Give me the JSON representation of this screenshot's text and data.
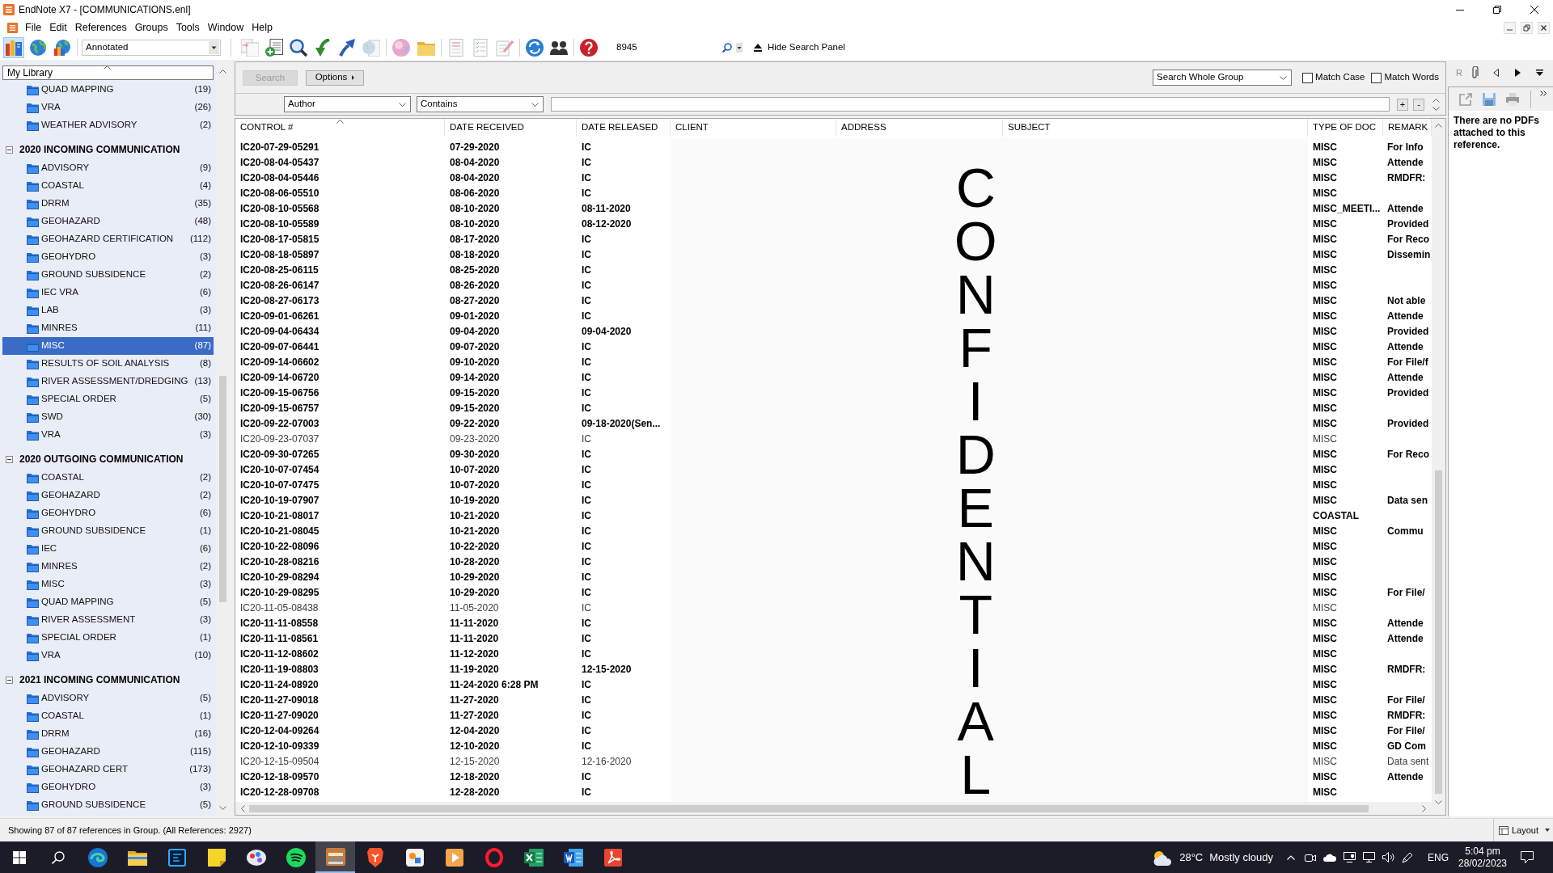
{
  "window": {
    "title": "EndNote X7 - [COMMUNICATIONS.enl]"
  },
  "menu": [
    "File",
    "Edit",
    "References",
    "Groups",
    "Tools",
    "Window",
    "Help"
  ],
  "toolbar": {
    "modes": [
      {
        "kind": "local",
        "selected": true
      },
      {
        "kind": "online",
        "selected": false
      },
      {
        "kind": "integrated",
        "selected": false
      }
    ],
    "style": "Annotated",
    "quick_search": "8945",
    "hide_search_panel": "Hide Search Panel"
  },
  "sidebar": {
    "library": "My Library",
    "group_sets": [
      {
        "children": [
          {
            "name": "QUAD MAPPING",
            "count": "(19)",
            "selected": false
          },
          {
            "name": "VRA",
            "count": "(26)",
            "selected": false
          },
          {
            "name": "WEATHER ADVISORY",
            "count": "(2)",
            "selected": false
          }
        ]
      },
      {
        "title": "2020 INCOMING COMMUNICATION",
        "expanded": true,
        "children": [
          {
            "name": "ADVISORY",
            "count": "(9)",
            "selected": false
          },
          {
            "name": "COASTAL",
            "count": "(4)",
            "selected": false
          },
          {
            "name": "DRRM",
            "count": "(35)",
            "selected": false
          },
          {
            "name": "GEOHAZARD",
            "count": "(48)",
            "selected": false
          },
          {
            "name": "GEOHAZARD CERTIFICATION",
            "count": "(112)",
            "selected": false
          },
          {
            "name": "GEOHYDRO",
            "count": "(3)",
            "selected": false
          },
          {
            "name": "GROUND SUBSIDENCE",
            "count": "(2)",
            "selected": false
          },
          {
            "name": "IEC VRA",
            "count": "(6)",
            "selected": false
          },
          {
            "name": "LAB",
            "count": "(3)",
            "selected": false
          },
          {
            "name": "MINRES",
            "count": "(11)",
            "selected": false
          },
          {
            "name": "MISC",
            "count": "(87)",
            "selected": true
          },
          {
            "name": "RESULTS OF SOIL ANALYSIS",
            "count": "(8)",
            "selected": false
          },
          {
            "name": "RIVER ASSESSMENT/DREDGING",
            "count": "(13)",
            "selected": false
          },
          {
            "name": "SPECIAL ORDER",
            "count": "(5)",
            "selected": false
          },
          {
            "name": "SWD",
            "count": "(30)",
            "selected": false
          },
          {
            "name": "VRA",
            "count": "(3)",
            "selected": false
          }
        ]
      },
      {
        "title": "2020 OUTGOING COMMUNICATION",
        "expanded": true,
        "children": [
          {
            "name": "COASTAL",
            "count": "(2)",
            "selected": false
          },
          {
            "name": "GEOHAZARD",
            "count": "(2)",
            "selected": false
          },
          {
            "name": "GEOHYDRO",
            "count": "(6)",
            "selected": false
          },
          {
            "name": "GROUND SUBSIDENCE",
            "count": "(1)",
            "selected": false
          },
          {
            "name": "IEC",
            "count": "(6)",
            "selected": false
          },
          {
            "name": "MINRES",
            "count": "(2)",
            "selected": false
          },
          {
            "name": "MISC",
            "count": "(3)",
            "selected": false
          },
          {
            "name": "QUAD MAPPING",
            "count": "(5)",
            "selected": false
          },
          {
            "name": "RIVER ASSESSMENT",
            "count": "(3)",
            "selected": false
          },
          {
            "name": "SPECIAL ORDER",
            "count": "(1)",
            "selected": false
          },
          {
            "name": "VRA",
            "count": "(10)",
            "selected": false
          }
        ]
      },
      {
        "title": "2021 INCOMING COMMUNICATION",
        "expanded": true,
        "children": [
          {
            "name": "ADVISORY",
            "count": "(5)",
            "selected": false
          },
          {
            "name": "COASTAL",
            "count": "(1)",
            "selected": false
          },
          {
            "name": "DRRM",
            "count": "(16)",
            "selected": false
          },
          {
            "name": "GEOHAZARD",
            "count": "(115)",
            "selected": false
          },
          {
            "name": "GEOHAZARD CERT",
            "count": "(173)",
            "selected": false
          },
          {
            "name": "GEOHYDRO",
            "count": "(3)",
            "selected": false
          },
          {
            "name": "GROUND SUBSIDENCE",
            "count": "(5)",
            "selected": false
          }
        ]
      }
    ]
  },
  "search_panel": {
    "search_button": {
      "label": "Search",
      "disabled": true
    },
    "options_button": "Options",
    "scope": "Search Whole Group",
    "match_case": {
      "label": "Match Case",
      "checked": false
    },
    "match_words": {
      "label": "Match Words",
      "checked": false
    },
    "field": "Author",
    "operator": "Contains",
    "add_button": "+",
    "remove_button": "-"
  },
  "table": {
    "columns": [
      {
        "label": "CONTROL #",
        "sorted": true
      },
      {
        "label": "DATE RECEIVED",
        "sorted": false
      },
      {
        "label": "DATE RELEASED",
        "sorted": false
      },
      {
        "label": "CLIENT",
        "sorted": false
      },
      {
        "label": "ADDRESS",
        "sorted": false
      },
      {
        "label": "SUBJECT",
        "sorted": false
      },
      {
        "label": "TYPE OF DOC",
        "sorted": false
      },
      {
        "label": "REMARK",
        "sorted": false
      }
    ],
    "rows": [
      {
        "control": "IC20-07-29-05291",
        "date_received": "07-29-2020",
        "date_released": "IC",
        "type_of_doc": "MISC",
        "remarks": "For Info",
        "unread": true
      },
      {
        "control": "IC20-08-04-05437",
        "date_received": "08-04-2020",
        "date_released": "IC",
        "type_of_doc": "MISC",
        "remarks": "Attende",
        "unread": true
      },
      {
        "control": "IC20-08-04-05446",
        "date_received": "08-04-2020",
        "date_released": "IC",
        "type_of_doc": "MISC",
        "remarks": "RMDFR:",
        "unread": true
      },
      {
        "control": "IC20-08-06-05510",
        "date_received": "08-06-2020",
        "date_released": "IC",
        "type_of_doc": "MISC",
        "unread": true
      },
      {
        "control": "IC20-08-10-05568",
        "date_received": "08-10-2020",
        "date_released": "08-11-2020",
        "type_of_doc": "MISC_MEETI...",
        "remarks": "Attende",
        "unread": true
      },
      {
        "control": "IC20-08-10-05589",
        "date_received": "08-10-2020",
        "date_released": "08-12-2020",
        "type_of_doc": "MISC",
        "remarks": "Provided",
        "unread": true
      },
      {
        "control": "IC20-08-17-05815",
        "date_received": "08-17-2020",
        "date_released": "IC",
        "type_of_doc": "MISC",
        "remarks": "For Reco",
        "unread": true
      },
      {
        "control": "IC20-08-18-05897",
        "date_received": "08-18-2020",
        "date_released": "IC",
        "type_of_doc": "MISC",
        "remarks": "Dissemin",
        "unread": true
      },
      {
        "control": "IC20-08-25-06115",
        "date_received": "08-25-2020",
        "date_released": "IC",
        "type_of_doc": "MISC",
        "unread": true
      },
      {
        "control": "IC20-08-26-06147",
        "date_received": "08-26-2020",
        "date_released": "IC",
        "type_of_doc": "MISC",
        "unread": true
      },
      {
        "control": "IC20-08-27-06173",
        "date_received": "08-27-2020",
        "date_released": "IC",
        "type_of_doc": "MISC",
        "remarks": "Not able",
        "unread": true
      },
      {
        "control": "IC20-09-01-06261",
        "date_received": "09-01-2020",
        "date_released": "IC",
        "type_of_doc": "MISC",
        "remarks": "Attende",
        "unread": true
      },
      {
        "control": "IC20-09-04-06434",
        "date_received": "09-04-2020",
        "date_released": "09-04-2020",
        "type_of_doc": "MISC",
        "remarks": "Provided",
        "unread": true
      },
      {
        "control": "IC20-09-07-06441",
        "date_received": "09-07-2020",
        "date_released": "IC",
        "type_of_doc": "MISC",
        "remarks": "Attende",
        "unread": true
      },
      {
        "control": "IC20-09-14-06602",
        "date_received": "09-10-2020",
        "date_released": "IC",
        "type_of_doc": "MISC",
        "remarks": "For File/f",
        "unread": true
      },
      {
        "control": "IC20-09-14-06720",
        "date_received": "09-14-2020",
        "date_released": "IC",
        "type_of_doc": "MISC",
        "remarks": "Attende",
        "unread": true
      },
      {
        "control": "IC20-09-15-06756",
        "date_received": "09-15-2020",
        "date_released": "IC",
        "type_of_doc": "MISC",
        "remarks": "Provided",
        "unread": true
      },
      {
        "control": "IC20-09-15-06757",
        "date_received": "09-15-2020",
        "date_released": "IC",
        "type_of_doc": "MISC",
        "unread": true
      },
      {
        "control": "IC20-09-22-07003",
        "date_received": "09-22-2020",
        "date_released": "09-18-2020(Sen...",
        "type_of_doc": "MISC",
        "remarks": "Provided",
        "unread": true
      },
      {
        "control": "IC20-09-23-07037",
        "date_received": "09-23-2020",
        "date_released": "IC",
        "type_of_doc": "MISC",
        "unread": false
      },
      {
        "control": "IC20-09-30-07265",
        "date_received": "09-30-2020",
        "date_released": "IC",
        "type_of_doc": "MISC",
        "remarks": "For Reco",
        "unread": true
      },
      {
        "control": "IC20-10-07-07454",
        "date_received": "10-07-2020",
        "date_released": "IC",
        "type_of_doc": "MISC",
        "unread": true
      },
      {
        "control": "IC20-10-07-07475",
        "date_received": "10-07-2020",
        "date_released": "IC",
        "type_of_doc": "MISC",
        "unread": true
      },
      {
        "control": "IC20-10-19-07907",
        "date_received": "10-19-2020",
        "date_released": "IC",
        "type_of_doc": "MISC",
        "remarks": "Data sen",
        "unread": true
      },
      {
        "control": "IC20-10-21-08017",
        "date_received": "10-21-2020",
        "date_released": "IC",
        "type_of_doc": "COASTAL",
        "unread": true
      },
      {
        "control": "IC20-10-21-08045",
        "date_received": "10-21-2020",
        "date_released": "IC",
        "type_of_doc": "MISC",
        "remarks": "Commu",
        "unread": true
      },
      {
        "control": "IC20-10-22-08096",
        "date_received": "10-22-2020",
        "date_released": "IC",
        "type_of_doc": "MISC",
        "unread": true
      },
      {
        "control": "IC20-10-28-08216",
        "date_received": "10-28-2020",
        "date_released": "IC",
        "type_of_doc": "MISC",
        "unread": true
      },
      {
        "control": "IC20-10-29-08294",
        "date_received": "10-29-2020",
        "date_released": "IC",
        "type_of_doc": "MISC",
        "unread": true
      },
      {
        "control": "IC20-10-29-08295",
        "date_received": "10-29-2020",
        "date_released": "IC",
        "type_of_doc": "MISC",
        "remarks": "For File/",
        "unread": true
      },
      {
        "control": "IC20-11-05-08438",
        "date_received": "11-05-2020",
        "date_released": "IC",
        "type_of_doc": "MISC",
        "unread": false
      },
      {
        "control": "IC20-11-11-08558",
        "date_received": "11-11-2020",
        "date_released": "IC",
        "type_of_doc": "MISC",
        "remarks": "Attende",
        "unread": true
      },
      {
        "control": "IC20-11-11-08561",
        "date_received": "11-11-2020",
        "date_released": "IC",
        "type_of_doc": "MISC",
        "remarks": "Attende",
        "unread": true
      },
      {
        "control": "IC20-11-12-08602",
        "date_received": "11-12-2020",
        "date_released": "IC",
        "type_of_doc": "MISC",
        "unread": true
      },
      {
        "control": "IC20-11-19-08803",
        "date_received": "11-19-2020",
        "date_released": "12-15-2020",
        "type_of_doc": "MISC",
        "remarks": "RMDFR:",
        "unread": true
      },
      {
        "control": "IC20-11-24-08920",
        "date_received": "11-24-2020 6:28 PM",
        "date_released": "IC",
        "type_of_doc": "MISC",
        "unread": true
      },
      {
        "control": "IC20-11-27-09018",
        "date_received": "11-27-2020",
        "date_released": "IC",
        "type_of_doc": "MISC",
        "remarks": "For File/",
        "unread": true
      },
      {
        "control": "IC20-11-27-09020",
        "date_received": "11-27-2020",
        "date_released": "IC",
        "type_of_doc": "MISC",
        "remarks": "RMDFR:",
        "unread": true
      },
      {
        "control": "IC20-12-04-09264",
        "date_received": "12-04-2020",
        "date_released": "IC",
        "type_of_doc": "MISC",
        "remarks": "For File/",
        "unread": true
      },
      {
        "control": "IC20-12-10-09339",
        "date_received": "12-10-2020",
        "date_released": "IC",
        "type_of_doc": "MISC",
        "remarks": "GD Com",
        "unread": true
      },
      {
        "control": "IC20-12-15-09504",
        "date_received": "12-15-2020",
        "date_released": "12-16-2020",
        "type_of_doc": "MISC",
        "remarks": "Data sent",
        "unread": false
      },
      {
        "control": "IC20-12-18-09570",
        "date_received": "12-18-2020",
        "date_released": "IC",
        "type_of_doc": "MISC",
        "remarks": "Attende",
        "unread": true
      },
      {
        "control": "IC20-12-28-09708",
        "date_received": "12-28-2020",
        "date_released": "IC",
        "type_of_doc": "MISC",
        "unread": true
      }
    ],
    "redaction": "CONFIDENTIAL"
  },
  "pdf_panel": {
    "tabs": [
      {
        "kind": "text",
        "label": "R",
        "selected": false
      },
      {
        "kind": "attachment",
        "selected": true
      }
    ],
    "message": "There are no PDFs attached to this reference."
  },
  "status_bar": {
    "text": "Showing 87 of 87 references in Group. (All References: 2927)",
    "layout_button": "Layout"
  },
  "taskbar": {
    "apps": [
      {
        "kind": "swirl",
        "active": false
      },
      {
        "kind": "folder",
        "active": false
      },
      {
        "kind": "photo",
        "active": false
      },
      {
        "kind": "note",
        "active": false
      },
      {
        "kind": "paint",
        "active": false
      },
      {
        "kind": "music",
        "active": false
      },
      {
        "kind": "library",
        "active": true
      },
      {
        "kind": "shield",
        "active": false
      },
      {
        "kind": "tile",
        "active": false
      },
      {
        "kind": "play",
        "active": false
      },
      {
        "kind": "ring",
        "active": false
      },
      {
        "kind": "sheet",
        "active": false
      },
      {
        "kind": "word",
        "active": false
      },
      {
        "kind": "pdf",
        "active": false
      }
    ],
    "temperature": "28°C",
    "weather": "Mostly cloudy",
    "language": "ENG",
    "time": "5:04 pm",
    "date": "28/02/2023"
  }
}
